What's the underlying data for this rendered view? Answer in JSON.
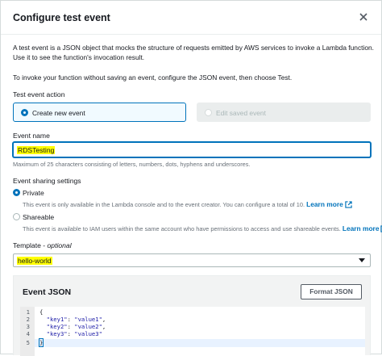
{
  "modal": {
    "title": "Configure test event",
    "desc_line1": "A test event is a JSON object that mocks the structure of requests emitted by AWS services to invoke a Lambda function.",
    "desc_line2": "Use it to see the function's invocation result.",
    "desc_line3": "To invoke your function without saving an event, configure the JSON event, then choose Test."
  },
  "test_event_action": {
    "label": "Test event action",
    "options": [
      {
        "label": "Create new event",
        "selected": true,
        "disabled": false
      },
      {
        "label": "Edit saved event",
        "selected": false,
        "disabled": true
      }
    ]
  },
  "event_name": {
    "label": "Event name",
    "value": "RDSTesting",
    "hint": "Maximum of 25 characters consisting of letters, numbers, dots, hyphens and underscores."
  },
  "sharing": {
    "label": "Event sharing settings",
    "private": {
      "label": "Private",
      "selected": true,
      "desc": "This event is only available in the Lambda console and to the event creator. You can configure a total of 10.",
      "link": "Learn more"
    },
    "shareable": {
      "label": "Shareable",
      "selected": false,
      "desc": "This event is available to IAM users within the same account who have permissions to access and use shareable events.",
      "link": "Learn more"
    }
  },
  "template": {
    "label": "Template",
    "optional": "optional",
    "separator": " - ",
    "value": "hello-world"
  },
  "event_json": {
    "title": "Event JSON",
    "format_button": "Format JSON",
    "lines": [
      {
        "num": "1",
        "text": "{"
      },
      {
        "num": "2",
        "key": "\"key1\"",
        "val": "\"value1\"",
        "comma": ","
      },
      {
        "num": "3",
        "key": "\"key2\"",
        "val": "\"value2\"",
        "comma": ","
      },
      {
        "num": "4",
        "key": "\"key3\"",
        "val": "\"value3\"",
        "comma": ""
      },
      {
        "num": "5",
        "text": "}"
      }
    ]
  },
  "colors": {
    "accent": "#0073bb",
    "highlight": "#ffff00"
  },
  "icons": {
    "close": "close-icon",
    "external": "external-link-icon",
    "caret": "caret-down-icon"
  }
}
